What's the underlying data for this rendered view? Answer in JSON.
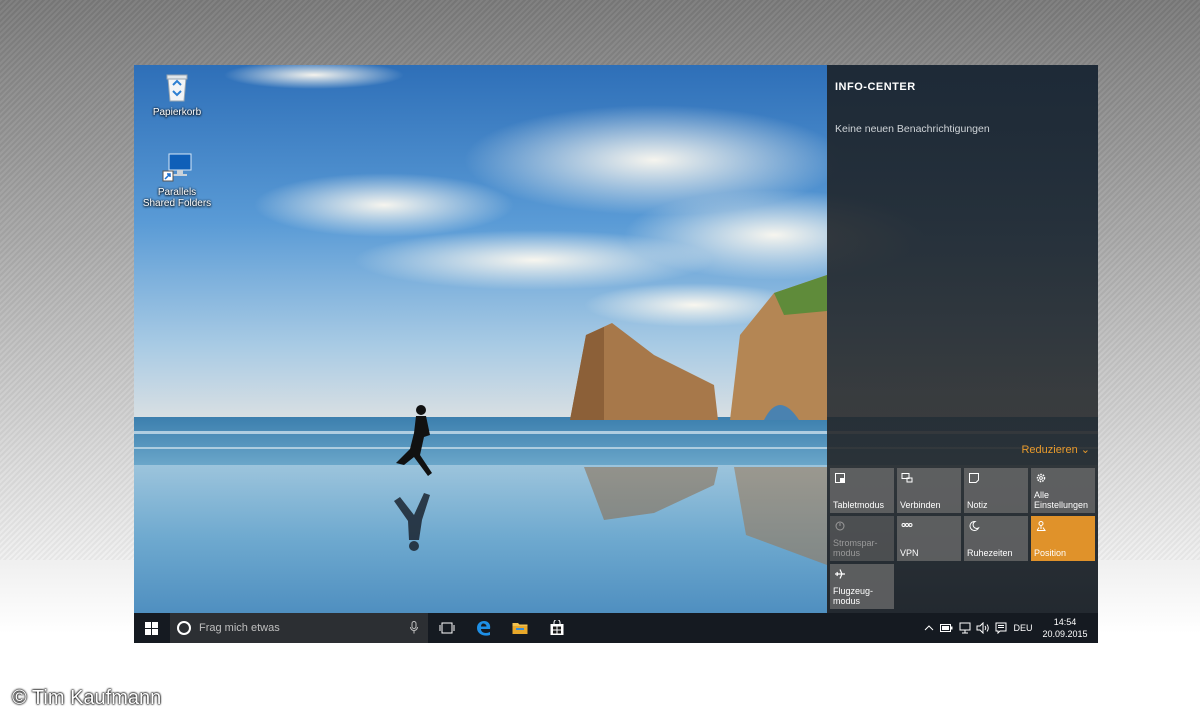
{
  "desktop": {
    "icons": [
      {
        "label": "Papierkorb",
        "icon": "recycle-bin-icon"
      },
      {
        "label": "Parallels Shared Folders",
        "icon": "monitor-shortcut-icon"
      }
    ]
  },
  "action_center": {
    "title": "INFO-CENTER",
    "empty_message": "Keine neuen Benachrichtigungen",
    "collapse_label": "Reduzieren",
    "accent_color": "#e0922a",
    "tiles": [
      {
        "label": "Tabletmodus",
        "icon": "tablet-mode-icon",
        "state": "normal"
      },
      {
        "label": "Verbinden",
        "icon": "connect-icon",
        "state": "normal"
      },
      {
        "label": "Notiz",
        "icon": "note-icon",
        "state": "normal"
      },
      {
        "label": "Alle Einstellungen",
        "icon": "gear-icon",
        "state": "normal"
      },
      {
        "label": "Stromspar-modus",
        "icon": "battery-saver-icon",
        "state": "disabled"
      },
      {
        "label": "VPN",
        "icon": "vpn-icon",
        "state": "normal"
      },
      {
        "label": "Ruhezeiten",
        "icon": "moon-icon",
        "state": "normal"
      },
      {
        "label": "Position",
        "icon": "location-icon",
        "state": "active"
      },
      {
        "label": "Flugzeug-modus",
        "icon": "airplane-icon",
        "state": "normal"
      }
    ]
  },
  "taskbar": {
    "search_placeholder": "Frag mich etwas",
    "pinned": [
      "task-view-icon",
      "edge-icon",
      "file-explorer-icon",
      "store-icon"
    ],
    "language": "DEU",
    "time": "14:54",
    "date": "20.09.2015"
  },
  "watermark": "© Tim Kaufmann"
}
